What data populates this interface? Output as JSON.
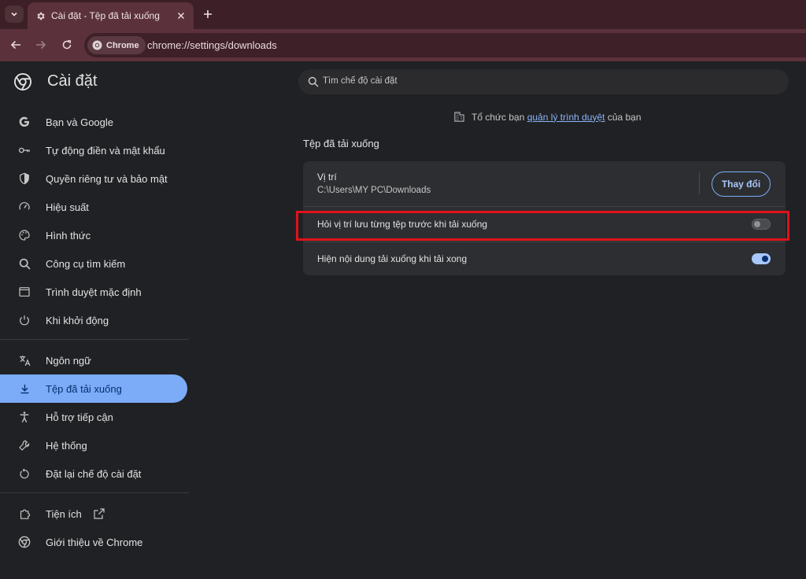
{
  "browser": {
    "tab_title": "Cài đặt - Tệp đã tải xuống",
    "chip_label": "Chrome",
    "url": "chrome://settings/downloads"
  },
  "header": {
    "title": "Cài đặt",
    "search_placeholder": "Tìm chế độ cài đặt"
  },
  "sidebar": {
    "items": [
      {
        "label": "Bạn và Google",
        "icon": "google-g-icon"
      },
      {
        "label": "Tự động điền và mật khẩu",
        "icon": "key-icon"
      },
      {
        "label": "Quyền riêng tư và bảo mật",
        "icon": "shield-icon"
      },
      {
        "label": "Hiệu suất",
        "icon": "speedometer-icon"
      },
      {
        "label": "Hình thức",
        "icon": "palette-icon"
      },
      {
        "label": "Công cụ tìm kiếm",
        "icon": "search-icon"
      },
      {
        "label": "Trình duyệt mặc định",
        "icon": "browser-window-icon"
      },
      {
        "label": "Khi khởi động",
        "icon": "power-icon"
      },
      {
        "label": "Ngôn ngữ",
        "icon": "translate-icon"
      },
      {
        "label": "Tệp đã tải xuống",
        "icon": "download-icon"
      },
      {
        "label": "Hỗ trợ tiếp cận",
        "icon": "accessibility-icon"
      },
      {
        "label": "Hệ thống",
        "icon": "wrench-icon"
      },
      {
        "label": "Đặt lại chế độ cài đặt",
        "icon": "reset-icon"
      },
      {
        "label": "Tiện ích",
        "icon": "puzzle-icon"
      },
      {
        "label": "Giới thiệu về Chrome",
        "icon": "chrome-icon"
      }
    ],
    "active_index": 9
  },
  "main": {
    "managed_prefix": "Tổ chức bạn",
    "managed_link": "quản lý trình duyệt",
    "managed_suffix": "của bạn",
    "section_title": "Tệp đã tải xuống",
    "location_label": "Vị trí",
    "location_path": "C:\\Users\\MY PC\\Downloads",
    "change_button": "Thay đổi",
    "ask_label": "Hỏi vị trí lưu từng tệp trước khi tải xuống",
    "ask_enabled": false,
    "show_label": "Hiện nội dung tải xuống khi tải xong",
    "show_enabled": true
  },
  "colors": {
    "accent": "#7cacf8",
    "highlight": "#e0111b"
  }
}
